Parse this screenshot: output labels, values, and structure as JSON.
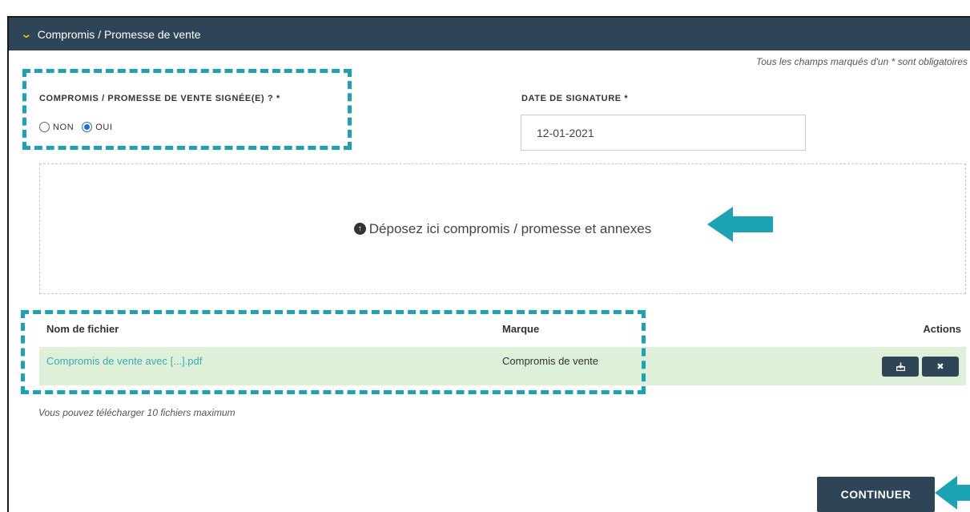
{
  "header": {
    "title": "Compromis / Promesse de vente"
  },
  "form": {
    "required_note": "Tous les champs marqués d'un * sont obligatoires",
    "signed_label": "COMPROMIS / PROMESSE DE VENTE SIGNÉE(E) ? *",
    "options": {
      "no": "NON",
      "yes": "OUI",
      "selected": "OUI"
    },
    "date_label": "DATE DE SIGNATURE *",
    "date_value": "12-01-2021"
  },
  "dropzone": {
    "text": "Déposez ici compromis / promesse et annexes"
  },
  "table": {
    "headers": {
      "name": "Nom de fichier",
      "mark": "Marque",
      "actions": "Actions"
    },
    "rows": [
      {
        "file": "Compromis de vente avec [...].pdf",
        "mark": "Compromis de vente"
      }
    ]
  },
  "limit_note": "Vous pouvez télécharger 10 fichiers maximum",
  "continue_label": "CONTINUER",
  "colors": {
    "header": "#2e4457",
    "accent": "#1aa3b5",
    "row": "#dff0d8",
    "link": "#3aa9b8"
  }
}
